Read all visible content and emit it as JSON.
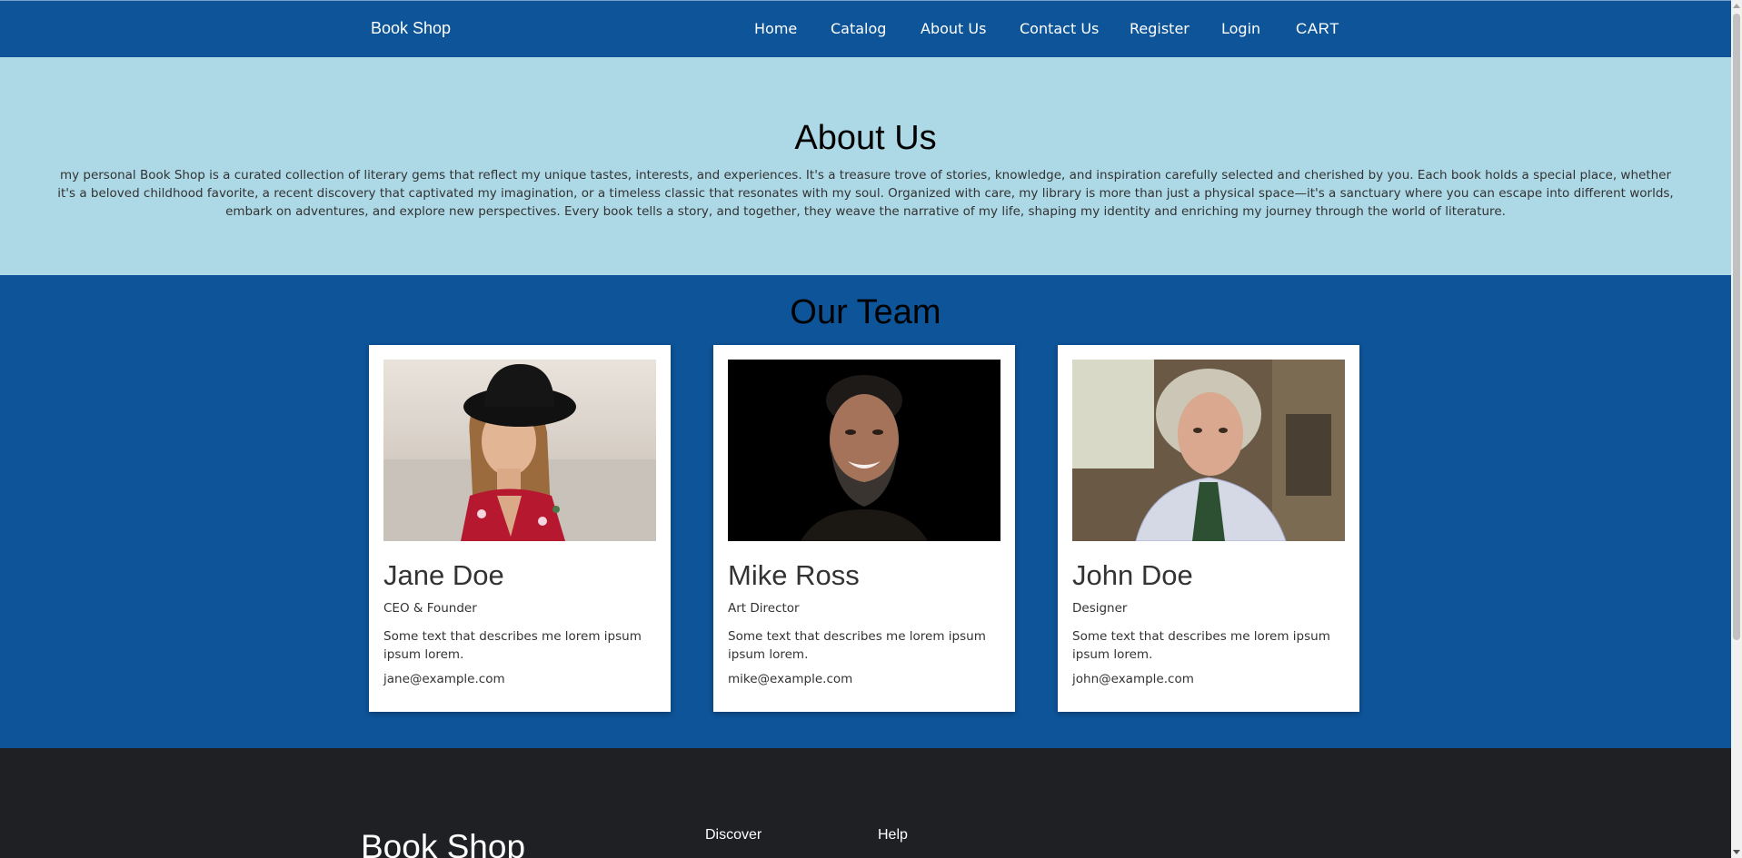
{
  "navbar": {
    "brand": "Book Shop",
    "items": [
      {
        "label": "Home"
      },
      {
        "label": "Catalog"
      },
      {
        "label": "About Us"
      },
      {
        "label": "Contact Us"
      },
      {
        "label": "Register"
      },
      {
        "label": "Login"
      },
      {
        "label": "CART"
      }
    ]
  },
  "about": {
    "title": "About Us",
    "text": "my personal Book Shop is a curated collection of literary gems that reflect my unique tastes, interests, and experiences. It's a treasure trove of stories, knowledge, and inspiration carefully selected and cherished by you. Each book holds a special place, whether it's a beloved childhood favorite, a recent discovery that captivated my imagination, or a timeless classic that resonates with my soul. Organized with care, my library is more than just a physical space—it's a sanctuary where you can escape into different worlds, embark on adventures, and explore new perspectives. Every book tells a story, and together, they weave the narrative of my life, shaping my identity and enriching my journey through the world of literature."
  },
  "team": {
    "title": "Our Team",
    "members": [
      {
        "name": "Jane Doe",
        "role": "CEO & Founder",
        "desc": "Some text that describes me lorem ipsum ipsum lorem.",
        "email": "jane@example.com"
      },
      {
        "name": "Mike Ross",
        "role": "Art Director",
        "desc": "Some text that describes me lorem ipsum ipsum lorem.",
        "email": "mike@example.com"
      },
      {
        "name": "John Doe",
        "role": "Designer",
        "desc": "Some text that describes me lorem ipsum ipsum lorem.",
        "email": "john@example.com"
      }
    ]
  },
  "footer": {
    "brand": "Book Shop",
    "columns": [
      {
        "heading": "Discover"
      },
      {
        "heading": "Help"
      }
    ]
  },
  "colors": {
    "nav_bg": "#0d5499",
    "about_bg": "#add8e6",
    "footer_bg": "#1f2024",
    "card_bg": "#ffffff"
  }
}
